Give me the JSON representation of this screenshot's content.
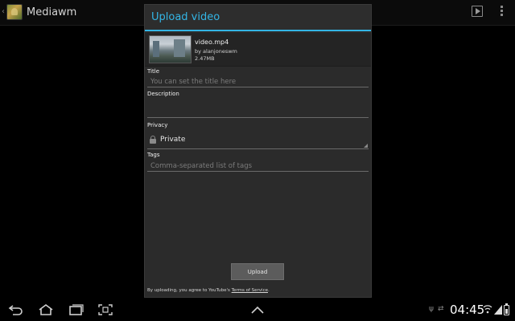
{
  "app_bar": {
    "title": "Mediawm",
    "icons": [
      "back-chevron-icon",
      "app-icon",
      "play-icon",
      "overflow-menu-icon"
    ]
  },
  "dialog": {
    "title": "Upload video",
    "file": {
      "name": "video.mp4",
      "author": "by alanjoneswm",
      "size": "2.47MB"
    },
    "fields": {
      "title_label": "Title",
      "title_placeholder": "You can set the title here",
      "description_label": "Description",
      "privacy_label": "Privacy",
      "privacy_value": "Private",
      "tags_label": "Tags",
      "tags_placeholder": "Comma-separated list of tags"
    },
    "upload_label": "Upload",
    "disclaimer_prefix": "By uploading, you agree to YouTube's ",
    "disclaimer_link": "Terms of Service",
    "disclaimer_suffix": "."
  },
  "system_bar": {
    "time": "04:45",
    "icons": [
      "back-icon",
      "home-icon",
      "recent-apps-icon",
      "screenshot-icon",
      "up-chevron-icon",
      "usb-icon",
      "sync-icon",
      "wifi-icon",
      "signal-icon",
      "battery-icon"
    ]
  },
  "colors": {
    "accent": "#33b5e5",
    "dialog_bg": "#2b2b2b",
    "background": "#000000"
  }
}
